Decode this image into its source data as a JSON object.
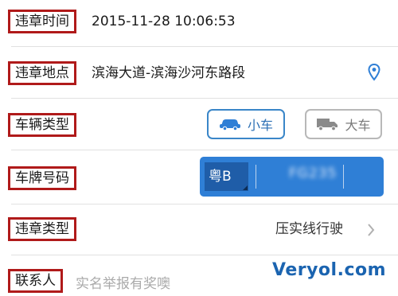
{
  "fields": {
    "time": {
      "label": "违章时间",
      "value": "2015-11-28 10:06:53"
    },
    "location": {
      "label": "违章地点",
      "value": "滨海大道-滨海沙河东路段",
      "icon": "location-pin-icon"
    },
    "vehicle_type": {
      "label": "车辆类型",
      "options": [
        {
          "label": "小车",
          "icon": "car-icon",
          "selected": true
        },
        {
          "label": "大车",
          "icon": "truck-icon",
          "selected": false
        }
      ]
    },
    "plate": {
      "label": "车牌号码",
      "prefix": "粤B",
      "number": "FG235"
    },
    "violation_type": {
      "label": "违章类型",
      "value": "压实线行驶",
      "icon": "chevron-right-icon"
    },
    "contact": {
      "label": "联系人",
      "placeholder": "实名举报有奖噢"
    }
  },
  "watermark": "Veryol.com",
  "colors": {
    "label_border": "#b01a1a",
    "accent": "#2f7fd6",
    "selected_text": "#2c6fb4",
    "placeholder": "#aaaaaa"
  }
}
